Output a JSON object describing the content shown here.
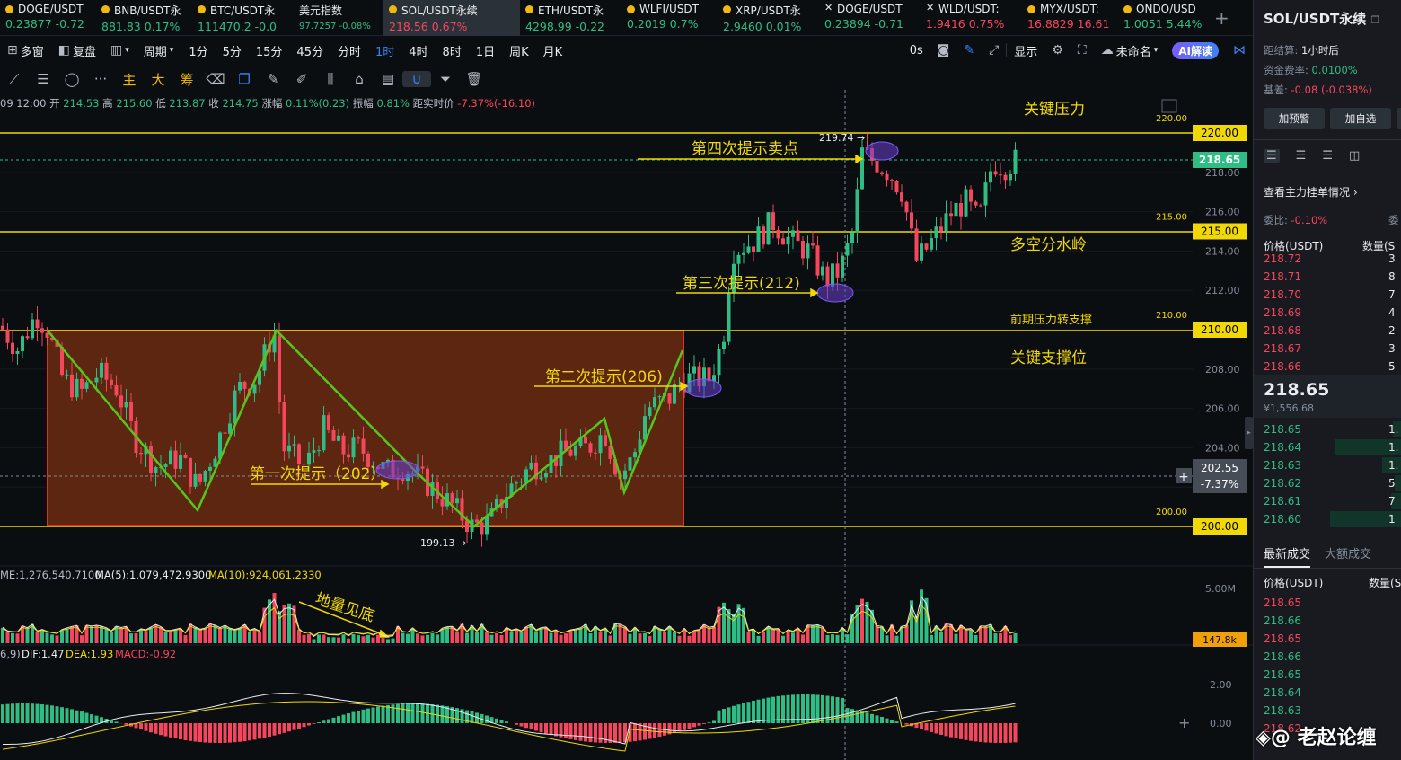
{
  "tickers": [
    {
      "name": "DOGE/USDT",
      "price": "0.23877",
      "change": "-0.72",
      "dir": "up",
      "icon": "coin-dot"
    },
    {
      "name": "BNB/USDT永",
      "price": "881.83",
      "change": "0.17%",
      "dir": "up",
      "icon": "coin-dot"
    },
    {
      "name": "BTC/USDT永",
      "price": "111470.2",
      "change": "-0.0",
      "dir": "up",
      "icon": "coin-dot"
    },
    {
      "name": "美元指数",
      "price": "97.7257",
      "change": "-0.08%",
      "dir": "up",
      "icon": "none",
      "small": true
    },
    {
      "name": "SOL/USDT永续",
      "price": "218.56",
      "change": "0.67%",
      "dir": "down",
      "icon": "coin-dot",
      "active": true
    },
    {
      "name": "ETH/USDT永",
      "price": "4298.99",
      "change": "-0.22",
      "dir": "up",
      "icon": "coin-dot"
    },
    {
      "name": "WLFI/USDT",
      "price": "0.2019",
      "change": "0.7%",
      "dir": "up",
      "icon": "coin-dot"
    },
    {
      "name": "XRP/USDT永",
      "price": "2.9460",
      "change": "0.01%",
      "dir": "up",
      "icon": "coin-dot"
    },
    {
      "name": "DOGE/USDT",
      "price": "0.23894",
      "change": "-0.71",
      "dir": "up",
      "icon": "x"
    },
    {
      "name": "WLD/USDT:",
      "price": "1.9416",
      "change": "0.75%",
      "dir": "down",
      "icon": "x"
    },
    {
      "name": "MYX/USDT:",
      "price": "16.8829",
      "change": "16.61",
      "dir": "down",
      "icon": "coin-dot"
    },
    {
      "name": "ONDO/USD",
      "price": "1.0051",
      "change": "5.44%",
      "dir": "up",
      "icon": "coin-dot"
    }
  ],
  "toolbar": {
    "multi_window": "多窗",
    "replay": "复盘",
    "period": "周期",
    "intervals": [
      "1分",
      "5分",
      "15分",
      "45分",
      "分时",
      "1时",
      "4时",
      "8时",
      "1日",
      "周K",
      "月K"
    ],
    "active_interval": "1时",
    "right_items": [
      "0s",
      "显示",
      "未命名"
    ],
    "ai_label": "AI解读"
  },
  "drawing_tools": {
    "text_items": [
      "主",
      "大",
      "筹"
    ]
  },
  "ohlc": {
    "time": "09 12:00",
    "open_label": "开",
    "open": "214.53",
    "high_label": "高",
    "high": "215.60",
    "low_label": "低",
    "low": "213.87",
    "close_label": "收",
    "close": "214.75",
    "change_label": "涨幅",
    "change": "0.11%(0.23)",
    "amp_label": "振幅",
    "amp": "0.81%",
    "dist_label": "距实时价",
    "dist": "-7.37%(-16.10)"
  },
  "chart": {
    "price_axis": [
      "220.00",
      "218.00",
      "216.00",
      "214.00",
      "212.00",
      "210.00",
      "208.00",
      "206.00",
      "204.00",
      "202.00",
      "200.00"
    ],
    "level_labels": [
      {
        "price": "220.00",
        "small": "220.00"
      },
      {
        "price": "215.00",
        "small": "215.00"
      },
      {
        "price": "210.00",
        "small": "210.00"
      },
      {
        "price": "200.00",
        "small": "200.00"
      }
    ],
    "last_price": "218.65",
    "cursor_price": "202.55",
    "cursor_pct": "-7.37%",
    "high_mark": "219.74 →",
    "low_mark": "199.13 →",
    "annotations": {
      "key_resistance": "关键压力",
      "bull_bear_divide": "多空分水岭",
      "prev_res_support": "前期压力转支撑",
      "key_support": "关键支撑位",
      "hint1": "第一次提示（202）",
      "hint2": "第二次提示(206)",
      "hint3": "第三次提示(212)",
      "hint4": "第四次提示卖点",
      "volume_bottom": "地量见底"
    },
    "volume": {
      "legend_prefix": "ME:1,276,540.7100",
      "ma5": "MA(5):1,079,472.9300",
      "ma10": "MA(10):924,061.2330",
      "axis_top": "5.00M",
      "current": "147.8k"
    },
    "macd": {
      "prefix": "6,9)",
      "dif": "DIF:1.47",
      "dea": "DEA:1.93",
      "macd": "MACD:-0.92",
      "axis": [
        "2.00",
        "0.00"
      ]
    }
  },
  "colors": {
    "up": "#2ebd85",
    "down": "#f6465d",
    "level_line": "#f0d800",
    "box_fill": "#6b2a10",
    "box_border": "#e03020",
    "zigzag": "#55c61a",
    "arrow": "#f0d800"
  },
  "panel": {
    "title": "SOL/USDT永续",
    "settle_label": "距结算:",
    "settle_value": "1小时后",
    "funding_label": "资金费率:",
    "funding_value": "0.0100%",
    "basis_label": "基差:",
    "basis_value": "-0.08 (-0.038%)",
    "btn_alert": "加预警",
    "btn_fav": "加自选",
    "view_main_orders": "查看主力挂单情况",
    "ratio_label": "委比:",
    "ratio_value": "-0.10%",
    "ratio_label2": "委",
    "col_price": "价格(USDT)",
    "col_qty": "数量(S",
    "asks": [
      {
        "price": "218.72",
        "qty": "3"
      },
      {
        "price": "218.71",
        "qty": "8"
      },
      {
        "price": "218.70",
        "qty": "7"
      },
      {
        "price": "218.69",
        "qty": "4"
      },
      {
        "price": "218.68",
        "qty": "2"
      },
      {
        "price": "218.67",
        "qty": "3"
      },
      {
        "price": "218.66",
        "qty": "5"
      }
    ],
    "mid_price": "218.65",
    "mid_cny": "¥1,556.68",
    "bids": [
      {
        "price": "218.65",
        "qty": "1.",
        "w": 10
      },
      {
        "price": "218.64",
        "qty": "1.",
        "w": 75
      },
      {
        "price": "218.63",
        "qty": "1.",
        "w": 22
      },
      {
        "price": "218.62",
        "qty": "5",
        "w": 8
      },
      {
        "price": "218.61",
        "qty": "7",
        "w": 12
      },
      {
        "price": "218.60",
        "qty": "1",
        "w": 80
      }
    ],
    "trade_tabs": [
      "最新成交",
      "大额成交"
    ],
    "trades_col_price": "价格(USDT)",
    "trades_col_qty": "数量(S",
    "trades": [
      {
        "price": "218.65",
        "dir": "down"
      },
      {
        "price": "218.66",
        "dir": "up"
      },
      {
        "price": "218.65",
        "dir": "down"
      },
      {
        "price": "218.66",
        "dir": "up"
      },
      {
        "price": "218.65",
        "dir": "up"
      },
      {
        "price": "218.64",
        "dir": "up"
      },
      {
        "price": "218.63",
        "dir": "up"
      },
      {
        "price": "218.62",
        "dir": "down"
      }
    ]
  },
  "watermark": "@ 老赵论缠"
}
